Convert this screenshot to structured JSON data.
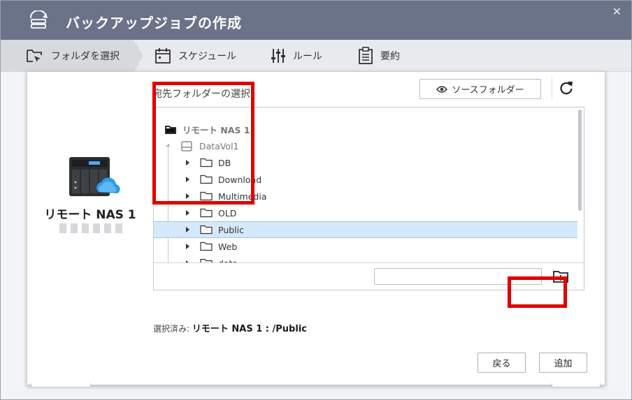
{
  "window": {
    "title": "バックアップジョブの作成",
    "close_glyph": "✕"
  },
  "steps": [
    {
      "label": "フォルダを選択",
      "icon": "folder-select-icon",
      "active": true
    },
    {
      "label": "スケジュール",
      "icon": "calendar-icon",
      "active": false
    },
    {
      "label": "ルール",
      "icon": "sliders-icon",
      "active": false
    },
    {
      "label": "要約",
      "icon": "clipboard-icon",
      "active": false
    }
  ],
  "nas": {
    "name": "リモート NAS 1"
  },
  "dest": {
    "label": "宛先フォルダーの選択:",
    "source_button": "ソースフォルダー"
  },
  "tree": {
    "root": "リモート NAS 1",
    "volume": "DataVol1",
    "folders": [
      "DB",
      "Download",
      "Multimedia",
      "OLD",
      "Public",
      "Web",
      "data"
    ],
    "selected_index": 4,
    "new_folder_value": ""
  },
  "selection": {
    "prefix": "選択済み:",
    "path": "リモート NAS 1 : /Public"
  },
  "buttons": {
    "back": "戻る",
    "add": "追加"
  },
  "colors": {
    "titlebar": "#6b7389",
    "highlight_red": "#e10000",
    "selected_row": "#d6e8fb"
  }
}
